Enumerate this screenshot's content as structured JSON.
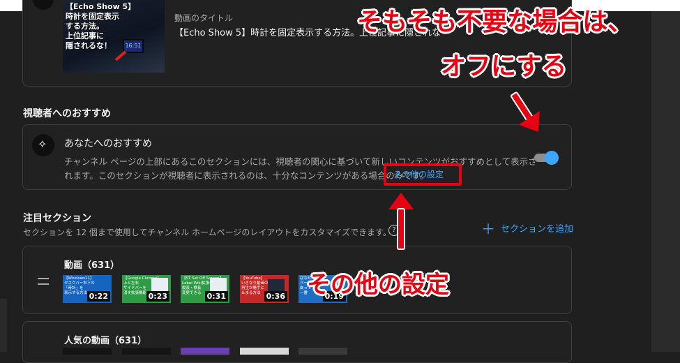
{
  "video": {
    "label": "動画のタイトル",
    "title": "【Echo Show 5】時計を固定表示する方法。上位記事に隠されな",
    "thumb_text": "【Echo Show 5】\n時計を固定表示\nする方法。\n上位記事に\n隠されるな！",
    "thumb_screen": "16:51"
  },
  "recommendations": {
    "heading": "視聴者へのおすすめ",
    "item_title": "あなたへのおすすめ",
    "description": "チャンネル ページの上部にあるこのセクションには、視聴者の関心に基づいて新しいコンテンツがおすすめとして表示されます。このセクションが視聴者に表示されるのは、十分なコンテンツがある場合のみです。",
    "more_settings_link": "その他の設定",
    "toggle_on": true,
    "toggle_color": "#3ea6ff"
  },
  "featured": {
    "heading": "注目セクション",
    "description": "セクションを 12 個まで使用してチャンネル ホームページのレイアウトをカスタマイズできます。",
    "help_icon": "?",
    "add_section_label": "セクションを追加",
    "add_icon": "plus-icon",
    "shelves": [
      {
        "title": "動画（631）",
        "thumbnails": [
          {
            "text": "【Windows11】\nタスクバー右下の\n「時計」を\n表示する方法",
            "duration": "0:22"
          },
          {
            "text": "【Google Chrome】\n上と左右\nサイドバーを\n消す拡張機能",
            "duration": "0:23"
          },
          {
            "text": "【ST Set Off Screen】\nLabel Wiki拡張子\n縦長・横長\n変更できる",
            "duration": "0:31"
          },
          {
            "text": "【YouTube】\nいきなり動画の\n再生が勝手に\n止まる方法",
            "duration": "0:36"
          },
          {
            "text": "ぱなせ\nページ\n戻って\n一番",
            "duration": "0:19"
          }
        ]
      },
      {
        "title": "人気の動画（631）"
      }
    ]
  },
  "annotations": {
    "top_line1": "そもそも不要な場合は、",
    "top_line2": "オフにする",
    "bottom": "その他の設定",
    "color": "#e60012"
  }
}
